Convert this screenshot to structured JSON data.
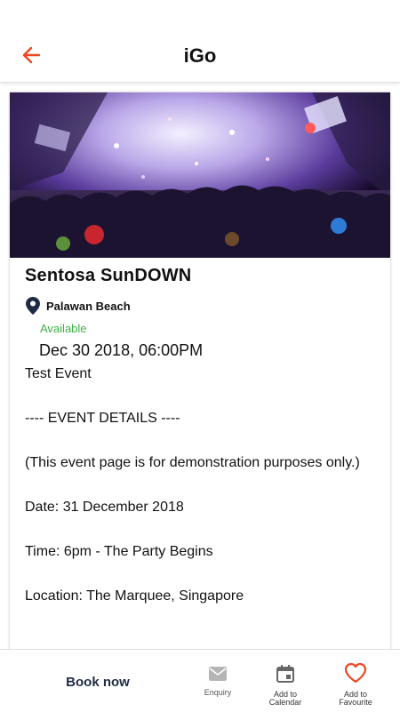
{
  "header": {
    "title": "iGo",
    "back_icon": "arrow-left-icon",
    "accent_color": "#f0461f"
  },
  "event": {
    "image_alt": "nightclub-party-crowd",
    "title": "Sentosa SunDOWN",
    "location": "Palawan Beach",
    "availability": "Available",
    "availability_color": "#3cb043",
    "date": "Dec 30 2018, 06:00PM",
    "description": [
      "Test Event",
      "",
      "---- EVENT DETAILS ----",
      "",
      "(This event page is for demonstration purposes only.)",
      "",
      "Date: 31 December 2018",
      "",
      "Time: 6pm - The Party Begins",
      "",
      "Location: The Marquee, Singapore"
    ]
  },
  "bottom_bar": {
    "book_label": "Book now",
    "actions": [
      {
        "icon": "mail-icon",
        "label": "Enquiry"
      },
      {
        "icon": "calendar-icon",
        "label": "Add to Calendar"
      },
      {
        "icon": "heart-icon",
        "label": "Add to Favourite"
      }
    ]
  }
}
